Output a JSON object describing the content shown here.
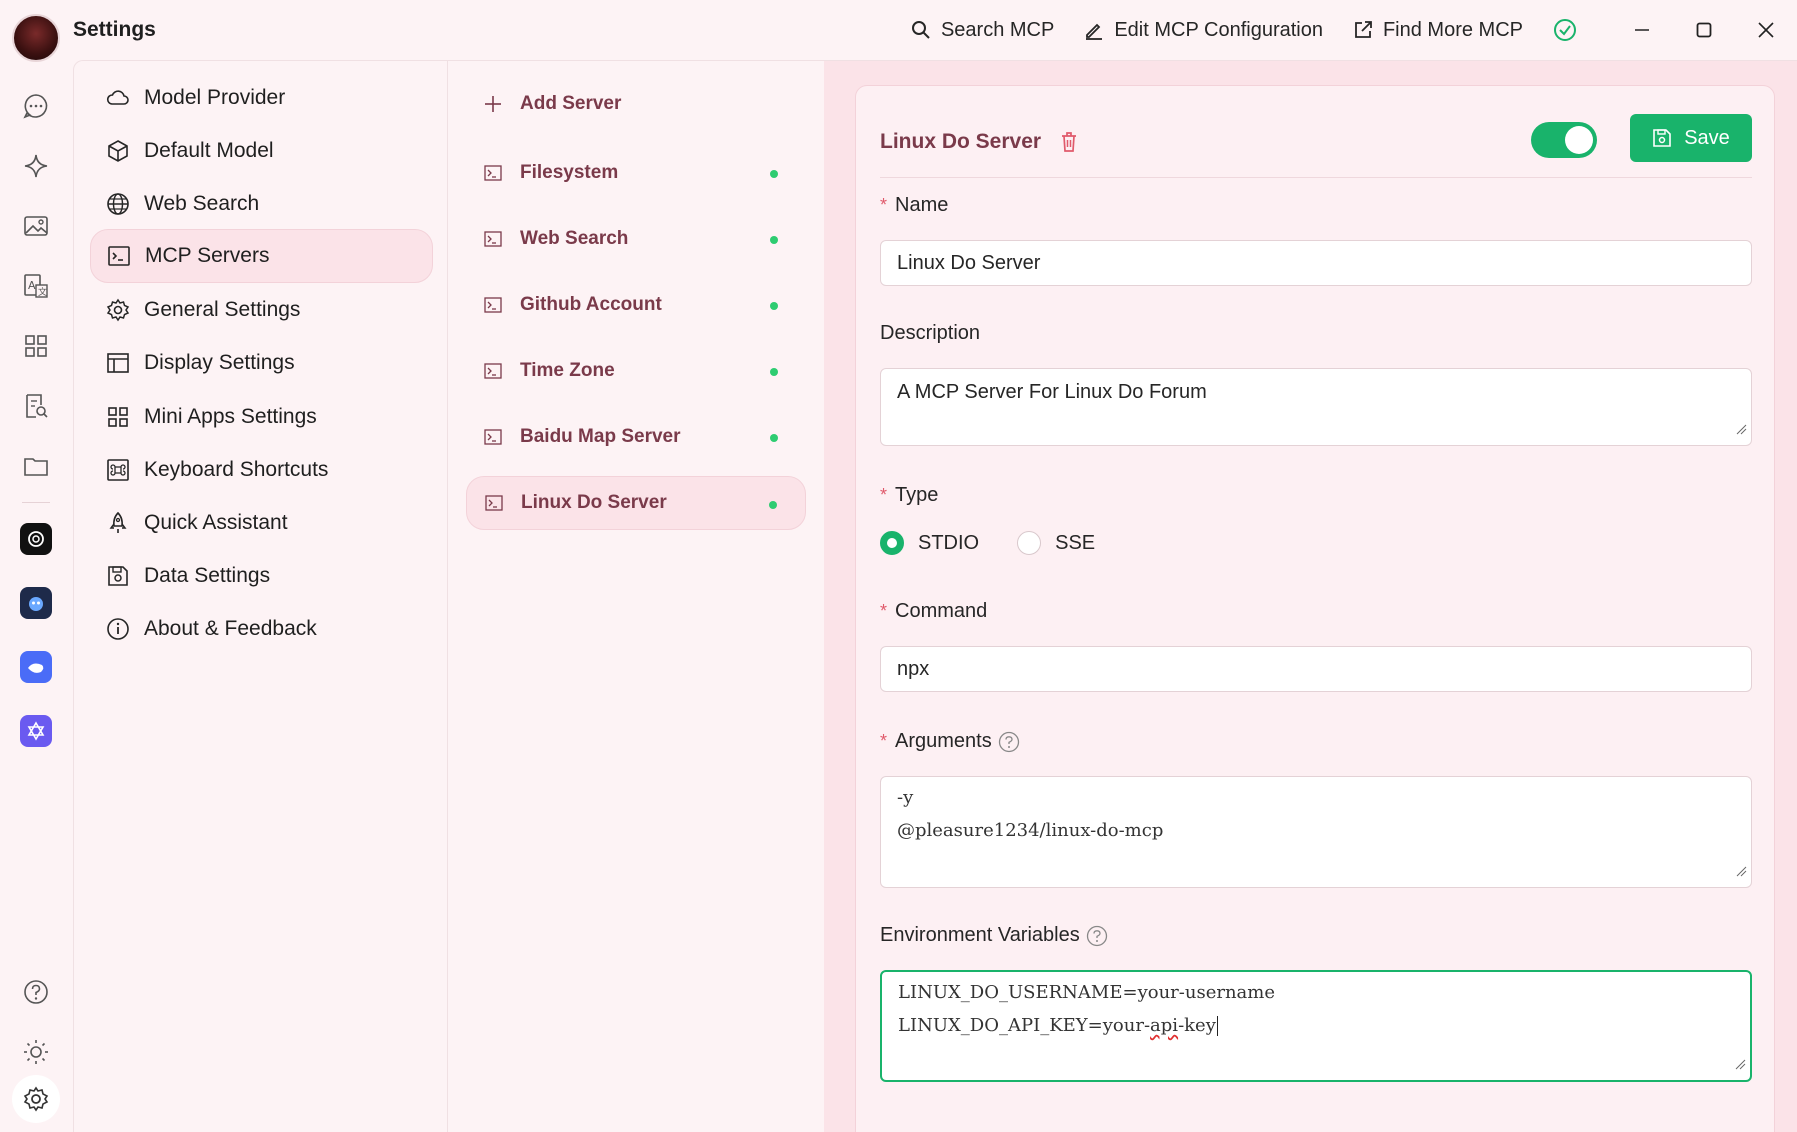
{
  "window": {
    "title": "Settings"
  },
  "top_actions": [
    {
      "label": "Search MCP",
      "icon": "search-icon"
    },
    {
      "label": "Edit MCP Configuration",
      "icon": "edit-icon"
    },
    {
      "label": "Find More MCP",
      "icon": "external-link-icon"
    }
  ],
  "settings_menu": {
    "items": [
      {
        "label": "Model Provider",
        "icon": "cloud-icon"
      },
      {
        "label": "Default Model",
        "icon": "cube-icon"
      },
      {
        "label": "Web Search",
        "icon": "globe-icon"
      },
      {
        "label": "MCP Servers",
        "icon": "terminal-icon",
        "active": true
      },
      {
        "label": "General Settings",
        "icon": "gear-icon"
      },
      {
        "label": "Display Settings",
        "icon": "layout-icon"
      },
      {
        "label": "Mini Apps Settings",
        "icon": "grid-icon"
      },
      {
        "label": "Keyboard Shortcuts",
        "icon": "command-icon"
      },
      {
        "label": "Quick Assistant",
        "icon": "rocket-icon"
      },
      {
        "label": "Data Settings",
        "icon": "save-icon"
      },
      {
        "label": "About & Feedback",
        "icon": "info-icon"
      }
    ]
  },
  "servers": {
    "add_label": "Add Server",
    "items": [
      {
        "label": "Filesystem",
        "active": false
      },
      {
        "label": "Web Search",
        "active": false
      },
      {
        "label": "Github Account",
        "active": false
      },
      {
        "label": "Time Zone",
        "active": false
      },
      {
        "label": "Baidu Map Server",
        "active": false
      },
      {
        "label": "Linux Do Server",
        "active": true
      }
    ]
  },
  "detail": {
    "title": "Linux Do Server",
    "enabled": true,
    "save_label": "Save",
    "name_label": "Name",
    "name_value": "Linux Do Server",
    "description_label": "Description",
    "description_value": "A MCP Server For Linux Do Forum",
    "type_label": "Type",
    "type_options": [
      "STDIO",
      "SSE"
    ],
    "type_selected": "STDIO",
    "command_label": "Command",
    "command_value": "npx",
    "arguments_label": "Arguments",
    "arguments_lines": [
      "-y",
      "@pleasure1234/linux-do-mcp"
    ],
    "env_label": "Environment Variables",
    "env_line1": "LINUX_DO_USERNAME=your-username",
    "env_line2_prefix": "LINUX_DO_API_KEY=your-",
    "env_line2_misspelled": "api",
    "env_line2_suffix": "-key"
  },
  "colors": {
    "accent": "#19b36b",
    "background": "#fdf3f5",
    "panel": "#fbe3e8",
    "brand_text": "#7a3a4a",
    "required": "#e05a6b"
  }
}
